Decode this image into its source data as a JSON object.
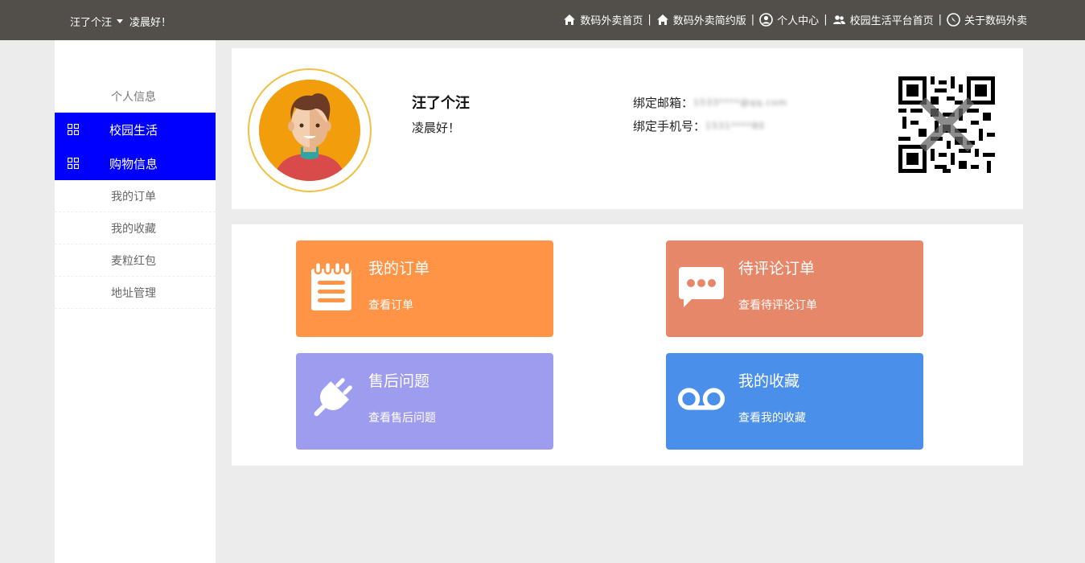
{
  "header": {
    "username": "汪了个汪",
    "greeting": "凌晨好！",
    "links": [
      {
        "label": "数码外卖首页",
        "icon": "home-icon"
      },
      {
        "label": "数码外卖简约版",
        "icon": "home-icon"
      },
      {
        "label": "个人中心",
        "icon": "user-circle-icon"
      },
      {
        "label": "校园生活平台首页",
        "icon": "users-icon"
      },
      {
        "label": "关于数码外卖",
        "icon": "compass-icon"
      }
    ],
    "separator": "|"
  },
  "sidebar": {
    "title": "个人信息",
    "groups": [
      {
        "label": "校园生活",
        "icon": "grid-icon"
      },
      {
        "label": "购物信息",
        "icon": "grid-icon"
      }
    ],
    "items": [
      {
        "label": "我的订单"
      },
      {
        "label": "我的收藏"
      },
      {
        "label": "麦粒红包"
      },
      {
        "label": "地址管理"
      }
    ]
  },
  "profile": {
    "name": "汪了个汪",
    "greeting": "凌晨好！",
    "email_label": "绑定邮箱：",
    "email_value": "1533****@qq.com",
    "phone_label": "绑定手机号：",
    "phone_value": "1531****80",
    "qr_icon": "qr-code-icon"
  },
  "cards": [
    {
      "title": "我的订单",
      "subtitle": "查看订单",
      "color": "#ff9346",
      "icon": "notepad-icon"
    },
    {
      "title": "待评论订单",
      "subtitle": "查看待评论订单",
      "color": "#e6876a",
      "icon": "chat-bubble-icon"
    },
    {
      "title": "售后问题",
      "subtitle": "查看售后问题",
      "color": "#9e9cee",
      "icon": "plug-icon"
    },
    {
      "title": "我的收藏",
      "subtitle": "查看我的收藏",
      "color": "#4a8fea",
      "icon": "voicemail-icon"
    }
  ],
  "colors": {
    "topbar": "#524f4a",
    "sidebar_active": "#0000ff",
    "page_bg": "#ececec"
  }
}
